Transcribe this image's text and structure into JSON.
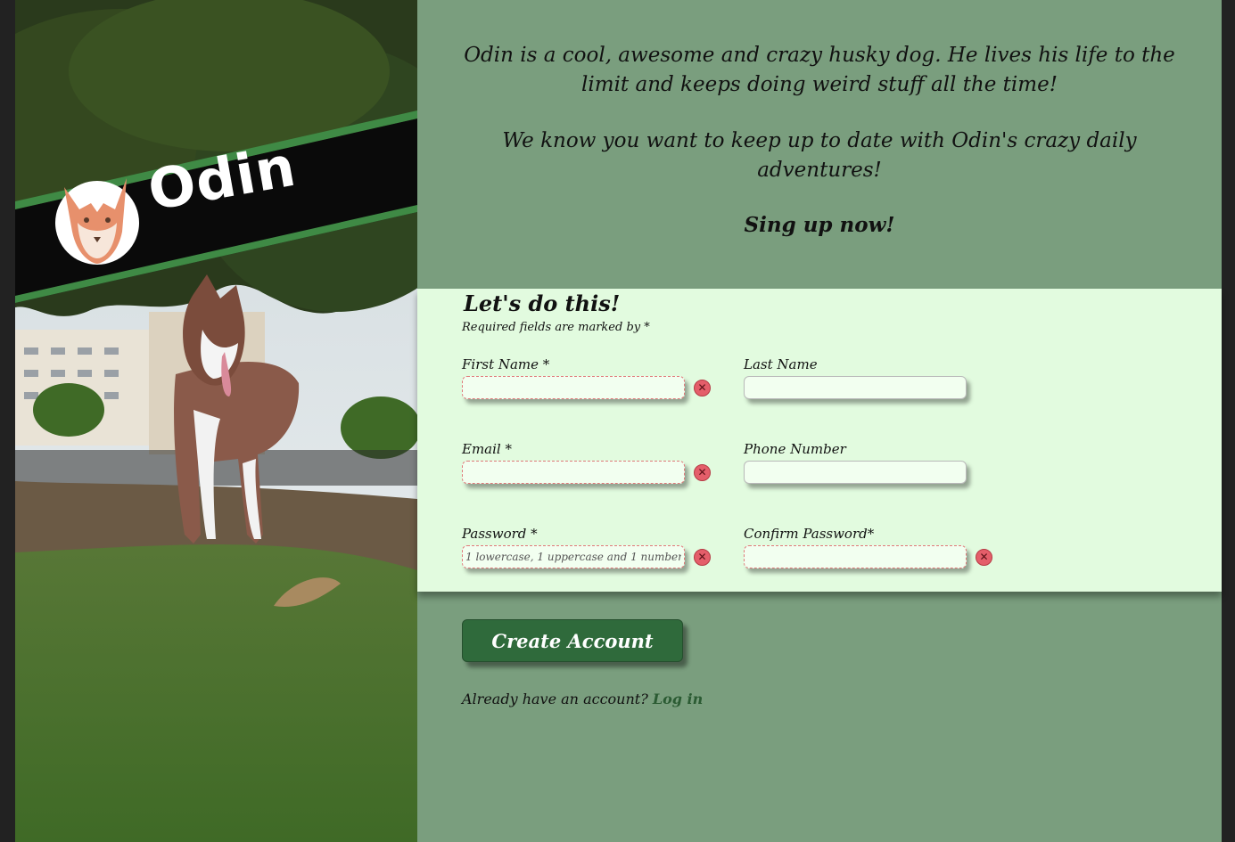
{
  "brand": {
    "name": "Odin",
    "logo": "fox-head-logo"
  },
  "intro": {
    "paragraph1": "Odin is a cool, awesome and crazy husky dog. He lives his life to the limit and keeps doing weird stuff all the time!",
    "paragraph2": "We know you want to keep up to date with Odin's crazy daily adventures!",
    "cta": "Sing up now!"
  },
  "form": {
    "title": "Let's do this!",
    "required_note": "Required fields are marked by *",
    "fields": {
      "first_name": {
        "label": "First Name *",
        "value": "",
        "placeholder": ""
      },
      "last_name": {
        "label": "Last Name",
        "value": "",
        "placeholder": ""
      },
      "email": {
        "label": "Email *",
        "value": "",
        "placeholder": ""
      },
      "phone": {
        "label": "Phone Number",
        "value": "",
        "placeholder": ""
      },
      "password": {
        "label": "Password *",
        "value": "",
        "placeholder": "1 lowercase, 1 uppercase and 1 number"
      },
      "confirm_password": {
        "label": "Confirm Password*",
        "value": "",
        "placeholder": ""
      }
    },
    "invalid_icon": "x-circle-icon",
    "submit_label": "Create Account"
  },
  "login": {
    "prompt": "Already have an account?",
    "link_label": "Log in"
  },
  "colors": {
    "main_bg": "#7a9e7e",
    "form_bg": "#e2fbdf",
    "button_bg": "#2f6a3b",
    "banner_stripe": "#3f8a45",
    "invalid_icon": "#e45e6a"
  }
}
